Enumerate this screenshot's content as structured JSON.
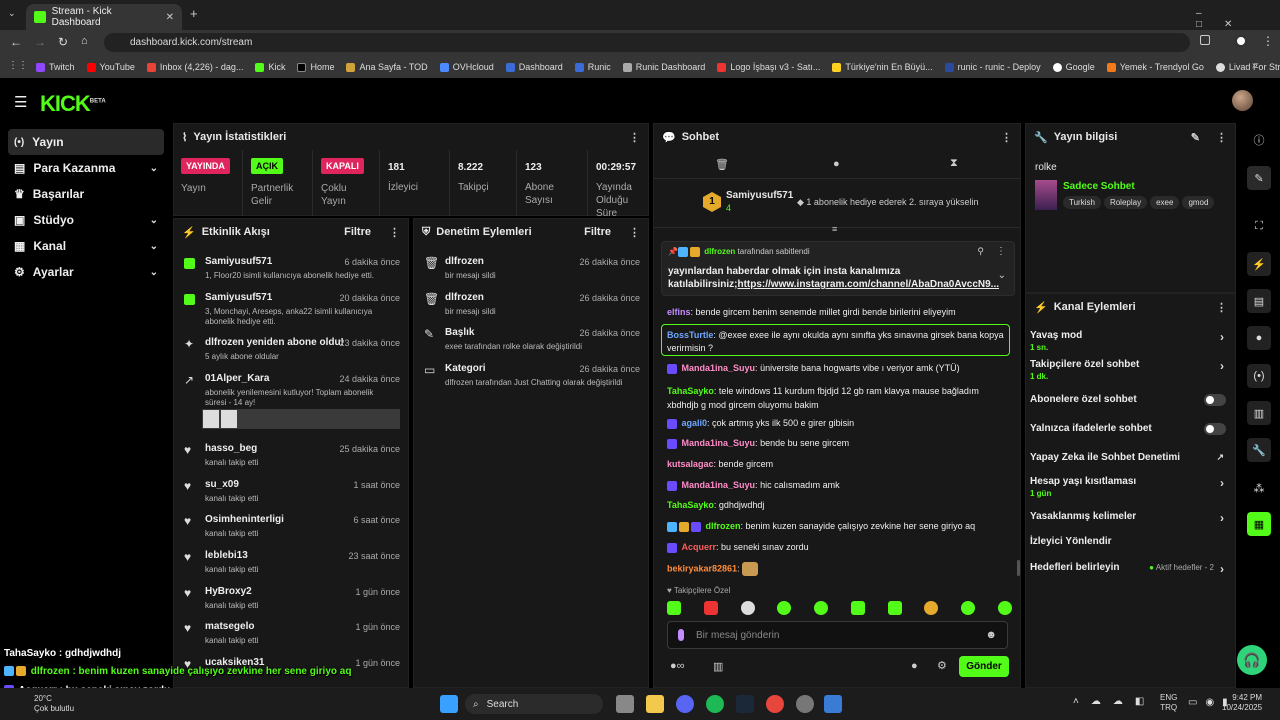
{
  "browser": {
    "tab_title": "Stream - Kick Dashboard",
    "url": "dashboard.kick.com/stream",
    "bookmarks": [
      "Twitch",
      "YouTube",
      "Inbox (4,226) - dag...",
      "Kick",
      "Home",
      "Ana Sayfa - TOD",
      "OVHcloud",
      "Dashboard",
      "Runic",
      "Runic Dashboard",
      "Logo İşbaşı v3 - Satı...",
      "Türkiye'nin En Büyü...",
      "runic - runic - Deploy",
      "Google",
      "Yemek - Trendyol Go",
      "Livad For Streamers"
    ]
  },
  "brand": {
    "logo": "KICK",
    "beta": "BETA",
    "accent": "#53fc18"
  },
  "sidebar": {
    "items": [
      {
        "label": "Yayın",
        "icon": "broadcast-icon"
      },
      {
        "label": "Para Kazanma",
        "icon": "money-icon"
      },
      {
        "label": "Başarılar",
        "icon": "trophy-icon"
      },
      {
        "label": "Stüdyo",
        "icon": "studio-icon"
      },
      {
        "label": "Kanal",
        "icon": "channel-icon"
      },
      {
        "label": "Ayarlar",
        "icon": "gear-icon"
      }
    ]
  },
  "stats": {
    "title": "Yayın İstatistikleri",
    "items": [
      {
        "badge": "YAYINDA",
        "label": "Yayın"
      },
      {
        "badge": "AÇIK",
        "label": "Partnerlik Gelir"
      },
      {
        "badge": "KAPALI",
        "label": "Çoklu Yayın"
      },
      {
        "value": "181",
        "label": "İzleyici"
      },
      {
        "value": "8.222",
        "label": "Takipçi"
      },
      {
        "value": "123",
        "label": "Abone Sayısı"
      },
      {
        "value": "00:29:57",
        "label": "Yayında Olduğu Süre"
      }
    ]
  },
  "activity": {
    "title": "Etkinlik Akışı",
    "filter": "Filtre",
    "items": [
      {
        "name": "Samiyusuf571",
        "time": "6 dakika önce",
        "desc": "1, Floor20 isimli kullanıcıya abonelik hediye etti."
      },
      {
        "name": "Samiyusuf571",
        "time": "20 dakika önce",
        "desc": "3, Monchayi, Areseps, anka22 isimli kullanıcıya abonelik hediye etti."
      },
      {
        "name": "dlfrozen yeniden abone oldu!",
        "time": "23 dakika önce",
        "desc": "5 aylık abone oldular"
      },
      {
        "name": "01Alper_Kara",
        "time": "24 dakika önce",
        "desc": "abonelik yenilemesini kutluyor! Toplam abonelik süresi - 14 ay!"
      },
      {
        "name": "hasso_beg",
        "time": "25 dakika önce",
        "desc": "kanalı takip etti"
      },
      {
        "name": "su_x09",
        "time": "1 saat önce",
        "desc": "kanalı takip etti"
      },
      {
        "name": "Osimheninterligi",
        "time": "6 saat önce",
        "desc": "kanalı takip etti"
      },
      {
        "name": "leblebi13",
        "time": "23 saat önce",
        "desc": "kanalı takip etti"
      },
      {
        "name": "HyBroxy2",
        "time": "1 gün önce",
        "desc": "kanalı takip etti"
      },
      {
        "name": "matsegelo",
        "time": "1 gün önce",
        "desc": "kanalı takip etti"
      },
      {
        "name": "ucaksiken31",
        "time": "1 gün önce",
        "desc": ""
      }
    ]
  },
  "moderation": {
    "title": "Denetim Eylemleri",
    "filter": "Filtre",
    "items": [
      {
        "name": "dlfrozen",
        "time": "26 dakika önce",
        "desc": "bir mesajı sildi"
      },
      {
        "name": "dlfrozen",
        "time": "26 dakika önce",
        "desc": "bir mesajı sildi"
      },
      {
        "name": "Başlık",
        "time": "26 dakika önce",
        "desc": "exee tarafından rolke olarak değiştirildi"
      },
      {
        "name": "Kategori",
        "time": "26 dakika önce",
        "desc": "dlfrozen tarafından Just Chatting olarak değiştirildi"
      }
    ]
  },
  "chat": {
    "title": "Sohbet",
    "gift": {
      "user": "Samiyusuf571",
      "count": "4",
      "text": "1 abonelik hediye ederek 2. sıraya yükselin"
    },
    "pinned": {
      "by": "dlfrozen",
      "by_suffix": "tarafından sabitlendi",
      "text": "yayınlardan haberdar olmak için insta kanalımıza katılabilirsiniz;",
      "link": "https://www.instagram.com/channel/AbaDna0AvccN9..."
    },
    "messages": [
      {
        "user": "elfins",
        "text": "bende gircem benim senemde millet girdi bende birilerini eliyeyim",
        "color": "#c58cff"
      },
      {
        "user": "BossTurtle",
        "text": "@exee exee ile aynı okulda aynı sınıfta yks sınavına girsek bana kopya verirmisin ?",
        "color": "#6fa7ff"
      },
      {
        "user": "Manda1ina_Suyu",
        "text": "üniversite bana hogwarts vibe ı veriyor amk (YTÜ)",
        "color": "#ff8cc8"
      },
      {
        "user": "TahaSayko",
        "text": "tele windows 11 kurdum fbjdjd 12 gb ram klavya mause bağladım xbdhdjb g mod gircem oluyomu bakim",
        "color": "#53fc18"
      },
      {
        "user": "agali0",
        "text": "çok artmış yks ilk 500 e girer gibisin",
        "color": "#6fa7ff"
      },
      {
        "user": "Manda1ina_Suyu",
        "text": "bende bu sene gircem",
        "color": "#ff8cc8"
      },
      {
        "user": "kutsalagac",
        "text": "bende gircem",
        "color": "#ff8cc8"
      },
      {
        "user": "Manda1ina_Suyu",
        "text": "hic calısmadım amk",
        "color": "#ff8cc8"
      },
      {
        "user": "TahaSayko",
        "text": "gdhdjwdhdj",
        "color": "#53fc18"
      },
      {
        "user": "dlfrozen",
        "text": "benim kuzen sanayide çalışıyo zevkine her sene giriyo aq",
        "color": "#53fc18"
      },
      {
        "user": "Acquerr",
        "text": "bu seneki sınav zordu",
        "color": "#ff5b5b"
      },
      {
        "user": "bekiryakar82861",
        "text": "",
        "color": "#ff8c3a"
      }
    ],
    "followers_only": "Takipçilere Özel",
    "input_placeholder": "Bir mesaj gönderin",
    "send": "Gönder"
  },
  "stream_info": {
    "title": "Yayın bilgisi",
    "stream_title": "rolke",
    "category": "Sadece Sohbet",
    "tags": [
      "Turkish",
      "Roleplay",
      "exee",
      "gmod"
    ]
  },
  "channel_actions": {
    "title": "Kanal Eylemleri",
    "items": [
      {
        "label": "Yavaş mod",
        "sub": "1 sn.",
        "kind": "arrow"
      },
      {
        "label": "Takipçilere özel sohbet",
        "sub": "1 dk.",
        "kind": "arrow"
      },
      {
        "label": "Abonelere özel sohbet",
        "sub": "",
        "kind": "toggle"
      },
      {
        "label": "Yalnızca ifadelerle sohbet",
        "sub": "",
        "kind": "toggle"
      },
      {
        "label": "Yapay Zeka ile Sohbet Denetimi",
        "sub": "",
        "kind": "external"
      },
      {
        "label": "Hesap yaşı kısıtlaması",
        "sub": "1 gün",
        "kind": "arrow"
      },
      {
        "label": "Yasaklanmış kelimeler",
        "sub": "",
        "kind": "arrow"
      },
      {
        "label": "İzleyici Yönlendir",
        "sub": "",
        "kind": "none"
      },
      {
        "label": "Hedefleri belirleyin",
        "sub": "",
        "kind": "goals"
      }
    ],
    "goals_status": "Aktif hedefler - 2"
  },
  "overlay": {
    "line1": "TahaSayko : gdhdjwdhdj",
    "line2": "dlfrozen : benim kuzen sanayide çalışıyo zevkine her sene giriyo aq",
    "line3": "Acquerr : bu seneki sınav zordu"
  },
  "taskbar": {
    "weather_temp": "20°C",
    "weather_desc": "Çok bulutlu",
    "search": "Search",
    "lang1": "ENG",
    "lang2": "TRQ",
    "time": "9:42 PM",
    "date": "10/24/2025"
  }
}
